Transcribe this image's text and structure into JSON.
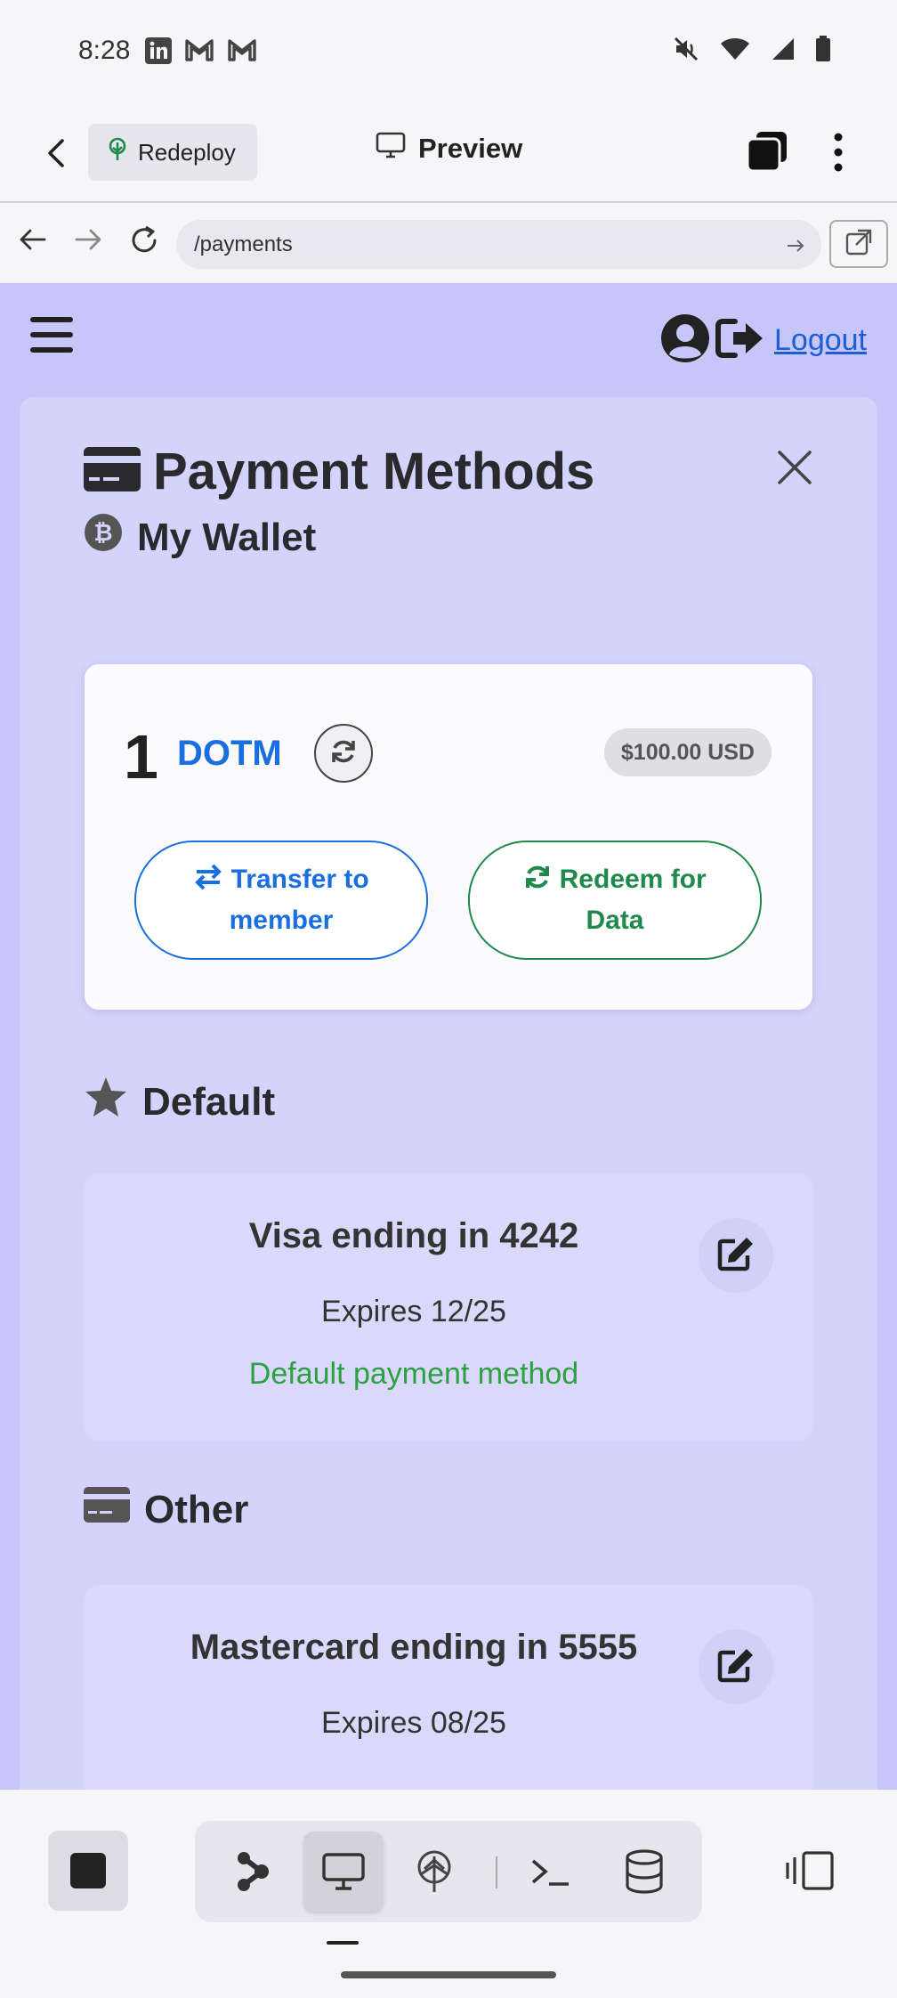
{
  "status_bar": {
    "time": "8:28"
  },
  "app_header": {
    "redeploy_label": "Redeploy",
    "preview_label": "Preview"
  },
  "browser": {
    "url": "/payments"
  },
  "nav": {
    "logout_label": "Logout"
  },
  "page": {
    "title": "Payment Methods",
    "wallet_section": {
      "heading": "My Wallet",
      "amount": "1",
      "token": "DOTM",
      "usd_value": "$100.00 USD",
      "transfer_line1": "Transfer to",
      "transfer_line2": "member",
      "redeem_line1": "Redeem for",
      "redeem_line2": "Data"
    },
    "default_section": {
      "heading": "Default",
      "card_name": "Visa ending in 4242",
      "expires": "Expires 12/25",
      "default_note": "Default payment method"
    },
    "other_section": {
      "heading": "Other",
      "card_name": "Mastercard ending in 5555",
      "expires": "Expires 08/25"
    }
  },
  "colors": {
    "page_bg": "#c7c6fa",
    "panel_bg": "#d4d3fb",
    "link_blue": "#1a5fd6",
    "token_blue": "#1a6fe0",
    "redeem_green": "#1f8a4c",
    "default_green": "#2ea043"
  }
}
